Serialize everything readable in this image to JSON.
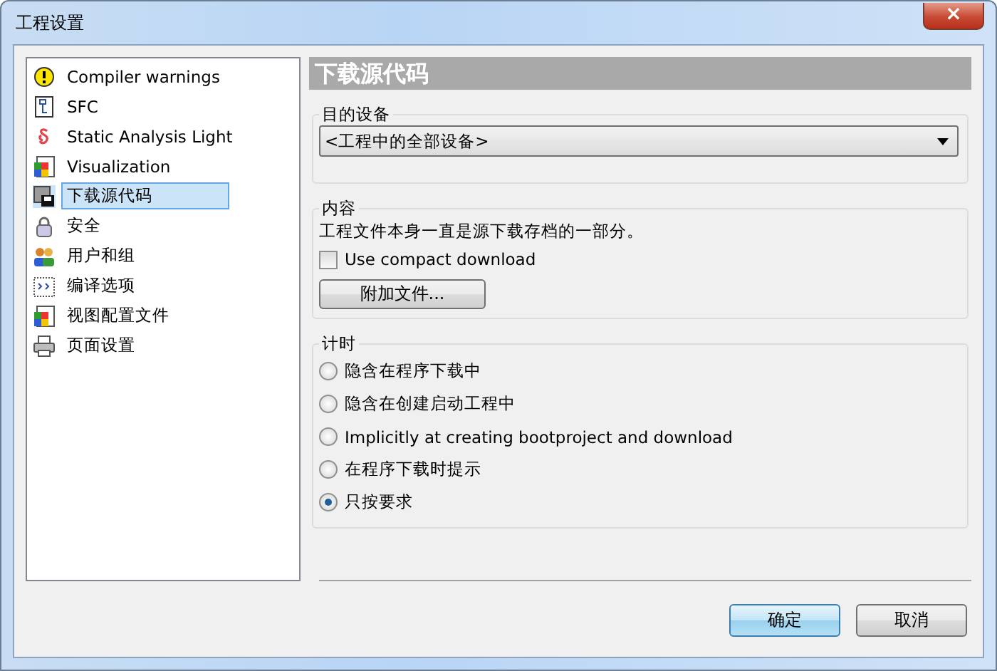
{
  "window": {
    "title": "工程设置",
    "close": "×"
  },
  "sidebar": {
    "items": [
      {
        "label": "Compiler warnings",
        "selected": false
      },
      {
        "label": "SFC",
        "selected": false
      },
      {
        "label": "Static Analysis Light",
        "selected": false
      },
      {
        "label": "Visualization",
        "selected": false
      },
      {
        "label": "下载源代码",
        "selected": true
      },
      {
        "label": "安全",
        "selected": false
      },
      {
        "label": "用户和组",
        "selected": false
      },
      {
        "label": "编译选项",
        "selected": false
      },
      {
        "label": "视图配置文件",
        "selected": false
      },
      {
        "label": "页面设置",
        "selected": false
      }
    ]
  },
  "panel": {
    "title": "下载源代码",
    "target_device": {
      "legend": "目的设备",
      "value": "<工程中的全部设备>"
    },
    "content": {
      "legend": "内容",
      "note": "工程文件本身一直是源下载存档的一部分。",
      "compact": {
        "label": "Use compact download",
        "checked": false
      },
      "button": "附加文件..."
    },
    "timing": {
      "legend": "计时",
      "options": [
        {
          "label": "隐含在程序下载中",
          "selected": false
        },
        {
          "label": "隐含在创建启动工程中",
          "selected": false
        },
        {
          "label": "Implicitly at creating bootproject and download",
          "selected": false
        },
        {
          "label": "在程序下载时提示",
          "selected": false
        },
        {
          "label": "只按要求",
          "selected": true
        }
      ]
    }
  },
  "buttons": [
    {
      "label": "确定",
      "default": true
    },
    {
      "label": "取消",
      "default": false
    }
  ]
}
